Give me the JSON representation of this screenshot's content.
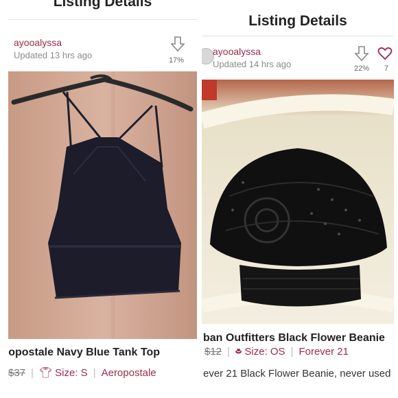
{
  "left": {
    "header_title": "Listing Details",
    "username": "ayooalyssa",
    "updated": "Updated 13 hrs ago",
    "percent": "17%",
    "title": "ropostale Navy Blue Tank Top",
    "price": "$37",
    "size": "Size: S",
    "brand": "Aeropostale",
    "icons": [
      "download-arrow-icon",
      "tshirt-icon"
    ]
  },
  "right": {
    "header_title": "Listing Details",
    "username": "ayooalyssa",
    "updated": "Updated 14 hrs ago",
    "percent": "22%",
    "likes": "7",
    "title": "ban Outfitters Black Flower Beanie",
    "price": "$12",
    "size": "Size: OS",
    "brand": "Forever 21",
    "description": "ever 21 Black Flower Beanie, never used",
    "icons": [
      "download-arrow-icon",
      "heart-icon",
      "hat-icon",
      "avatar"
    ]
  },
  "colors": {
    "accent": "#9b2a4a",
    "muted": "#8a8a8a",
    "text": "#222222"
  }
}
